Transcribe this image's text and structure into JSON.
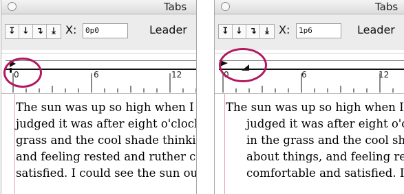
{
  "panels": [
    {
      "title": "Tabs",
      "tab_buttons": [
        "↧",
        "↓",
        "↴",
        "⤓"
      ],
      "x_label": "X:",
      "x_value": "0p0",
      "leader_label": "Leader",
      "ruler_labels": [
        "0",
        "6",
        "12"
      ],
      "text_lines": [
        "The sun was up so high when I woke",
        "judged it was after eight o'clock. I",
        "grass and the cool shade thinking",
        "and feeling rested and ruther comfo",
        "satisfied. I could see the sun out a"
      ]
    },
    {
      "title": "Tabs",
      "tab_buttons": [
        "↧",
        "↓",
        "↴",
        "⤓"
      ],
      "x_label": "X:",
      "x_value": "1p6",
      "leader_label": "Leader",
      "ruler_labels": [
        "0",
        "6",
        "12"
      ],
      "text_lines": [
        "The sun was up so high when I woke",
        "judged it was after eight o'clock.",
        "in the grass and the cool shade",
        "about things, and feeling rested",
        "comfortable and satisfied. I could"
      ]
    }
  ],
  "colors": {
    "highlight_ring": "#b3185f",
    "margin_guide": "#e3a0b8"
  }
}
